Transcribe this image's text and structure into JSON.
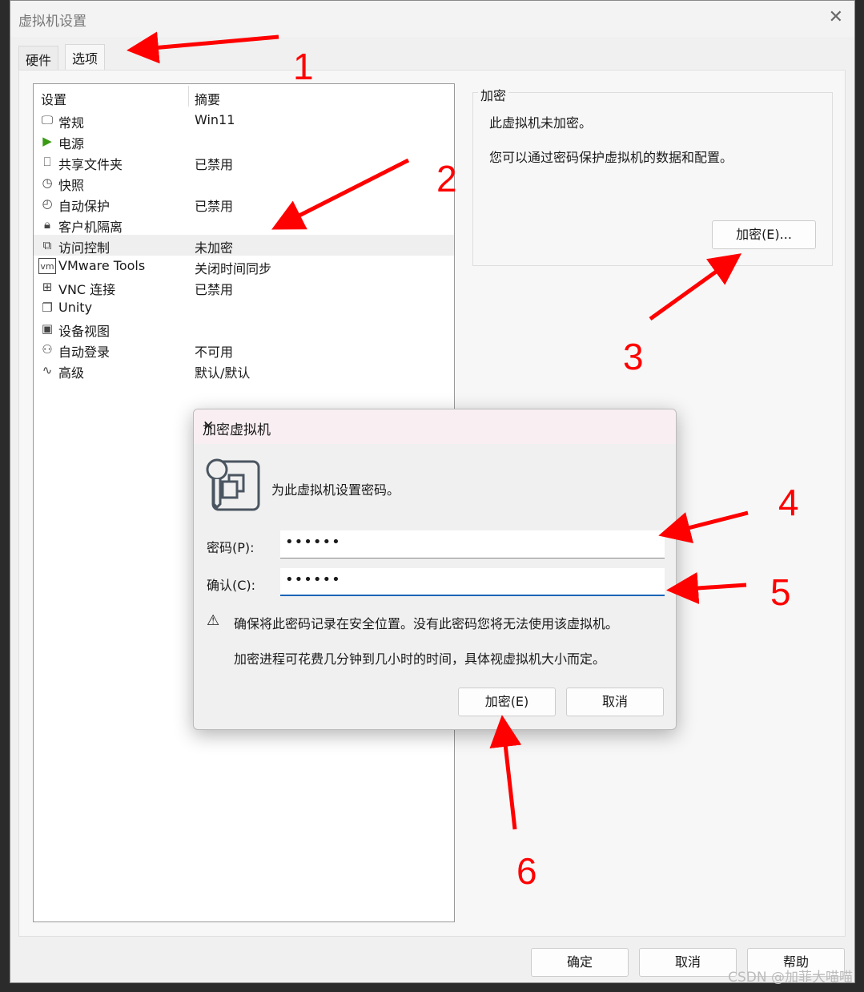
{
  "window": {
    "title": "虚拟机设置",
    "close_icon": "close-icon"
  },
  "tabs": [
    {
      "label": "硬件"
    },
    {
      "label": "选项",
      "active": true
    }
  ],
  "list": {
    "headers": [
      "设置",
      "摘要"
    ],
    "items": [
      {
        "icon": "monitor-icon",
        "name": "常规",
        "summary": "Win11"
      },
      {
        "icon": "power-play-icon",
        "name": "电源",
        "summary": ""
      },
      {
        "icon": "shared-folder-icon",
        "name": "共享文件夹",
        "summary": "已禁用"
      },
      {
        "icon": "snapshot-icon",
        "name": "快照",
        "summary": ""
      },
      {
        "icon": "clock-icon",
        "name": "自动保护",
        "summary": "已禁用"
      },
      {
        "icon": "lock-icon",
        "name": "客户机隔离",
        "summary": ""
      },
      {
        "icon": "access-control-icon",
        "name": "访问控制",
        "summary": "未加密",
        "selected": true
      },
      {
        "icon": "vm-icon",
        "name": "VMware Tools",
        "summary": "关闭时间同步"
      },
      {
        "icon": "vnc-icon",
        "name": "VNC 连接",
        "summary": "已禁用"
      },
      {
        "icon": "unity-icon",
        "name": "Unity",
        "summary": ""
      },
      {
        "icon": "device-view-icon",
        "name": "设备视图",
        "summary": ""
      },
      {
        "icon": "autologin-icon",
        "name": "自动登录",
        "summary": "不可用"
      },
      {
        "icon": "advanced-icon",
        "name": "高级",
        "summary": "默认/默认"
      }
    ]
  },
  "encryption": {
    "group_label": "加密",
    "status": "此虚拟机未加密。",
    "description": "您可以通过密码保护虚拟机的数据和配置。",
    "encrypt_button": "加密(E)..."
  },
  "footer": {
    "ok": "确定",
    "cancel": "取消",
    "help": "帮助"
  },
  "modal": {
    "title": "加密虚拟机",
    "prompt": "为此虚拟机设置密码。",
    "password_label": "密码(P):",
    "password_value": "••••••",
    "confirm_label": "确认(C):",
    "confirm_value": "••••••",
    "warning": "确保将此密码记录在安全位置。没有此密码您将无法使用该虚拟机。",
    "note": "加密进程可花费几分钟到几小时的时间，具体视虚拟机大小而定。",
    "encrypt_button": "加密(E)",
    "cancel_button": "取消"
  },
  "annotations": [
    "1",
    "2",
    "3",
    "4",
    "5",
    "6"
  ],
  "annotation_color": "#ff0000",
  "watermark": "CSDN @加菲大喵喵"
}
